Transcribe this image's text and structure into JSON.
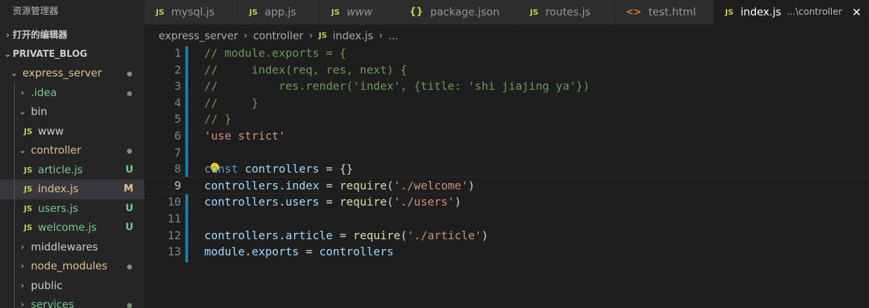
{
  "sidebar": {
    "title": "资源管理器",
    "open_editors_label": "打开的编辑器",
    "project_label": "PRIVATE_BLOG",
    "tree": [
      {
        "label": "express_server",
        "kind": "folder",
        "expanded": true,
        "status": "dot-gray"
      },
      {
        "label": ".idea",
        "kind": "folder",
        "expanded": false,
        "status": "dot-green"
      },
      {
        "label": "bin",
        "kind": "folder",
        "expanded": true,
        "status": ""
      },
      {
        "label": "www",
        "kind": "js",
        "status": ""
      },
      {
        "label": "controller",
        "kind": "folder",
        "expanded": true,
        "status": "dot-gray"
      },
      {
        "label": "article.js",
        "kind": "js",
        "status": "U"
      },
      {
        "label": "index.js",
        "kind": "js",
        "status": "M"
      },
      {
        "label": "users.js",
        "kind": "js",
        "status": "U"
      },
      {
        "label": "welcome.js",
        "kind": "js",
        "status": "U"
      },
      {
        "label": "middlewares",
        "kind": "folder",
        "expanded": false,
        "status": ""
      },
      {
        "label": "node_modules",
        "kind": "folder",
        "expanded": false,
        "status": "dot-gray"
      },
      {
        "label": "public",
        "kind": "folder",
        "expanded": false,
        "status": ""
      },
      {
        "label": "services",
        "kind": "folder",
        "expanded": false,
        "status": "dot-green"
      }
    ]
  },
  "tabs": [
    {
      "label": "mysql.js",
      "icon": "JS"
    },
    {
      "label": "app.js",
      "icon": "JS"
    },
    {
      "label": "www",
      "icon": "JS"
    },
    {
      "label": "package.json",
      "icon": "{}"
    },
    {
      "label": "routes.js",
      "icon": "JS"
    },
    {
      "label": "test.html",
      "icon": "<>"
    },
    {
      "label": "index.js",
      "icon": "JS",
      "sub": "...\\controller",
      "close": "✕"
    }
  ],
  "breadcrumb": {
    "items": [
      "express_server",
      "controller",
      "index.js",
      "..."
    ],
    "file_icon": "JS",
    "separator": "›"
  },
  "editor": {
    "current_line": 9,
    "lines": [
      {
        "n": "1",
        "text": "// module.exports = {"
      },
      {
        "n": "2",
        "text": "//     index(req, res, next) {"
      },
      {
        "n": "3",
        "text": "//         res.render('index', {title: 'shi jiajing ya'})"
      },
      {
        "n": "4",
        "text": "//     }"
      },
      {
        "n": "5",
        "text": "// }"
      },
      {
        "n": "6",
        "text": "'use strict'"
      },
      {
        "n": "7",
        "text": ""
      },
      {
        "n": "8",
        "text": "const controllers = {}"
      },
      {
        "n": "9",
        "text": "controllers.index = require('./welcome')"
      },
      {
        "n": "10",
        "text": "controllers.users = require('./users')"
      },
      {
        "n": "11",
        "text": ""
      },
      {
        "n": "12",
        "text": "controllers.article = require('./article')"
      },
      {
        "n": "13",
        "text": "module.exports = controllers"
      }
    ]
  },
  "colors": {
    "js_icon": "#cbcb41",
    "untracked": "#73c991",
    "modified": "#e2c08d",
    "accent_bar": "#1b81a8"
  }
}
